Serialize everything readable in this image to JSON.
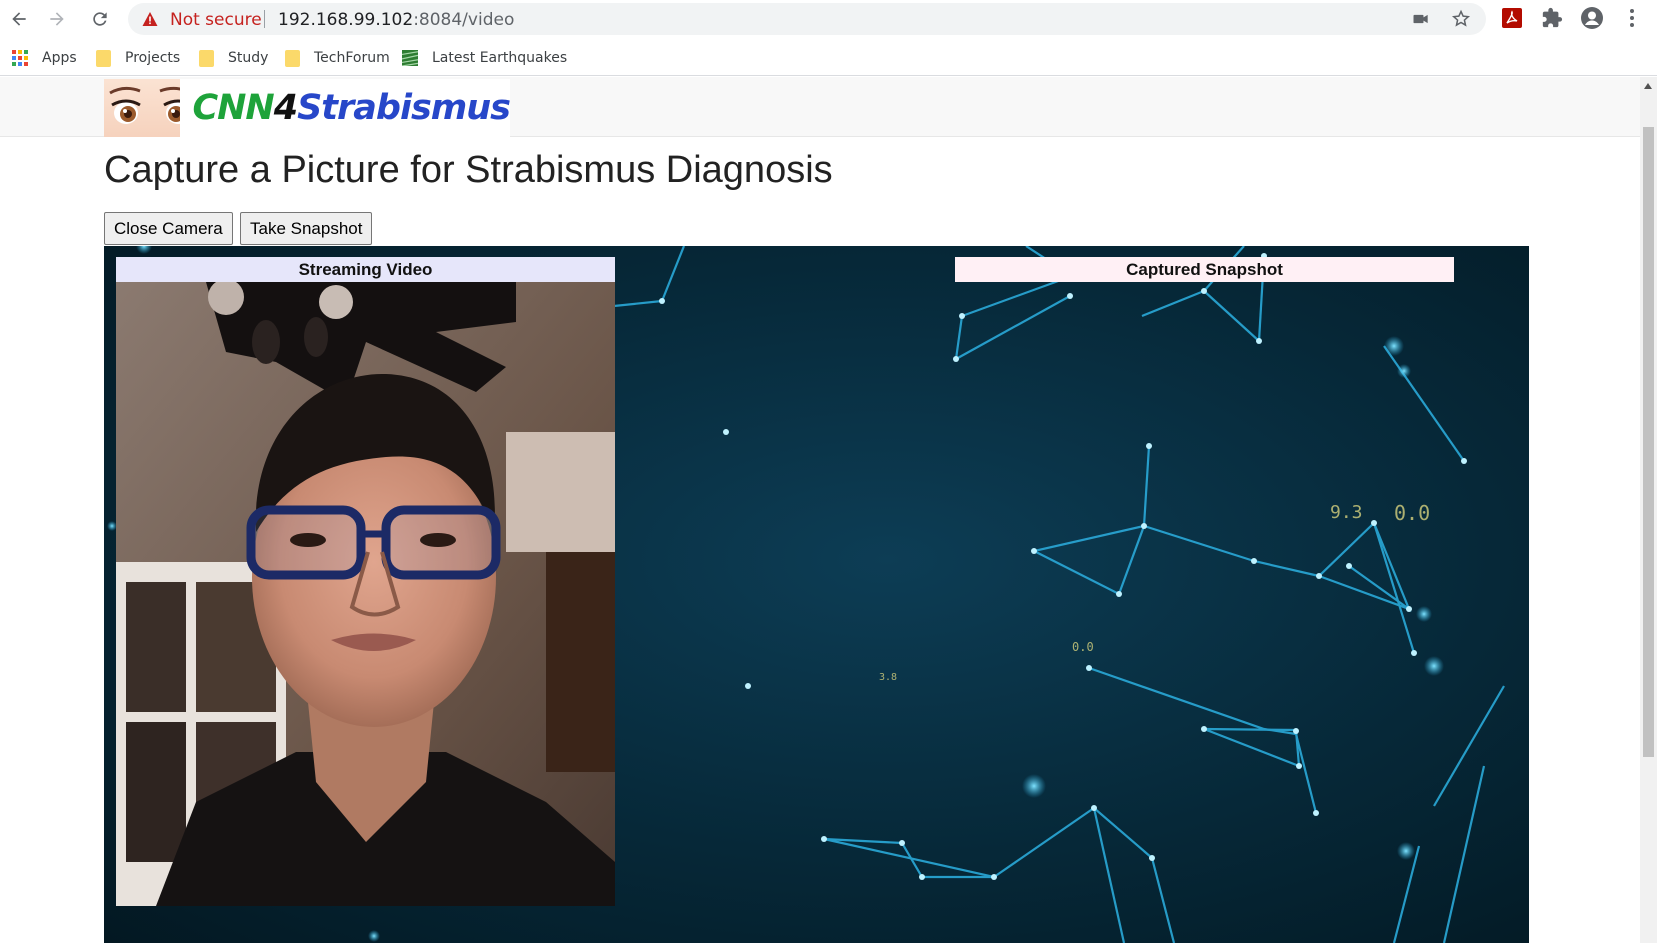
{
  "browser": {
    "security_label": "Not secure",
    "url_host": "192.168.99.102",
    "url_rest": ":8084/video",
    "icons": [
      "back-icon",
      "forward-icon",
      "reload-icon",
      "warning-icon",
      "camera-icon",
      "star-icon",
      "pdf-extension-icon",
      "extensions-icon",
      "profile-icon",
      "menu-icon"
    ]
  },
  "bookmarks": [
    {
      "label": "Apps",
      "icon": "apps-grid-icon"
    },
    {
      "label": "Projects",
      "icon": "folder-icon"
    },
    {
      "label": "Study",
      "icon": "folder-icon"
    },
    {
      "label": "TechForum",
      "icon": "folder-icon"
    },
    {
      "label": "Latest Earthquakes",
      "icon": "earthquake-icon"
    }
  ],
  "site": {
    "logo_text_cnn": "CNN",
    "logo_text_4": "4",
    "logo_text_rest": "Strabismus"
  },
  "page": {
    "title": "Capture a Picture for Strabismus Diagnosis",
    "close_camera_label": "Close Camera",
    "take_snapshot_label": "Take Snapshot",
    "streaming_video_header": "Streaming Video",
    "captured_snapshot_header": "Captured Snapshot",
    "bg_numbers": [
      "9.3",
      "0.0",
      "0.0",
      "3.8"
    ]
  },
  "colors": {
    "streaming_header_bg": "#e6e6fa",
    "snapshot_header_bg": "#fff0f5",
    "stage_bg": "#062838",
    "network_line": "#2aa9d8",
    "not_secure": "#c5221f"
  }
}
